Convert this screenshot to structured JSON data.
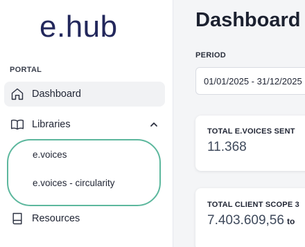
{
  "brand": {
    "logo_text": "e.hub",
    "color": "#23285c"
  },
  "sidebar": {
    "section_label": "PORTAL",
    "items": [
      {
        "label": "Dashboard",
        "icon": "home-icon",
        "active": true
      },
      {
        "label": "Libraries",
        "icon": "book-open-icon",
        "expanded": true,
        "children": [
          {
            "label": "e.voices"
          },
          {
            "label": "e.voices - circularity"
          }
        ]
      },
      {
        "label": "Resources",
        "icon": "book-icon"
      }
    ],
    "highlight_color": "#5cb79d"
  },
  "main": {
    "title": "Dashboard",
    "period": {
      "label": "PERIOD",
      "value": "01/01/2025 - 31/12/2025"
    },
    "cards": [
      {
        "title": "TOTAL E.VOICES SENT",
        "value": "11.368",
        "unit": ""
      },
      {
        "title": "TOTAL CLIENT SCOPE 3",
        "value": "7.403.609,56",
        "unit": "to"
      }
    ]
  }
}
